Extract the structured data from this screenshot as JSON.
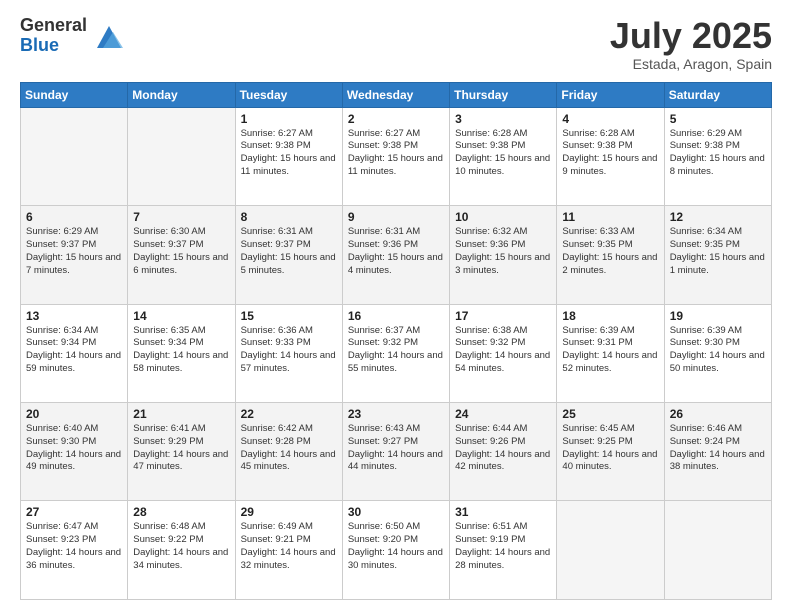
{
  "header": {
    "logo_general": "General",
    "logo_blue": "Blue",
    "month": "July 2025",
    "location": "Estada, Aragon, Spain"
  },
  "weekdays": [
    "Sunday",
    "Monday",
    "Tuesday",
    "Wednesday",
    "Thursday",
    "Friday",
    "Saturday"
  ],
  "weeks": [
    [
      {
        "day": "",
        "info": ""
      },
      {
        "day": "",
        "info": ""
      },
      {
        "day": "1",
        "info": "Sunrise: 6:27 AM\nSunset: 9:38 PM\nDaylight: 15 hours and 11 minutes."
      },
      {
        "day": "2",
        "info": "Sunrise: 6:27 AM\nSunset: 9:38 PM\nDaylight: 15 hours and 11 minutes."
      },
      {
        "day": "3",
        "info": "Sunrise: 6:28 AM\nSunset: 9:38 PM\nDaylight: 15 hours and 10 minutes."
      },
      {
        "day": "4",
        "info": "Sunrise: 6:28 AM\nSunset: 9:38 PM\nDaylight: 15 hours and 9 minutes."
      },
      {
        "day": "5",
        "info": "Sunrise: 6:29 AM\nSunset: 9:38 PM\nDaylight: 15 hours and 8 minutes."
      }
    ],
    [
      {
        "day": "6",
        "info": "Sunrise: 6:29 AM\nSunset: 9:37 PM\nDaylight: 15 hours and 7 minutes."
      },
      {
        "day": "7",
        "info": "Sunrise: 6:30 AM\nSunset: 9:37 PM\nDaylight: 15 hours and 6 minutes."
      },
      {
        "day": "8",
        "info": "Sunrise: 6:31 AM\nSunset: 9:37 PM\nDaylight: 15 hours and 5 minutes."
      },
      {
        "day": "9",
        "info": "Sunrise: 6:31 AM\nSunset: 9:36 PM\nDaylight: 15 hours and 4 minutes."
      },
      {
        "day": "10",
        "info": "Sunrise: 6:32 AM\nSunset: 9:36 PM\nDaylight: 15 hours and 3 minutes."
      },
      {
        "day": "11",
        "info": "Sunrise: 6:33 AM\nSunset: 9:35 PM\nDaylight: 15 hours and 2 minutes."
      },
      {
        "day": "12",
        "info": "Sunrise: 6:34 AM\nSunset: 9:35 PM\nDaylight: 15 hours and 1 minute."
      }
    ],
    [
      {
        "day": "13",
        "info": "Sunrise: 6:34 AM\nSunset: 9:34 PM\nDaylight: 14 hours and 59 minutes."
      },
      {
        "day": "14",
        "info": "Sunrise: 6:35 AM\nSunset: 9:34 PM\nDaylight: 14 hours and 58 minutes."
      },
      {
        "day": "15",
        "info": "Sunrise: 6:36 AM\nSunset: 9:33 PM\nDaylight: 14 hours and 57 minutes."
      },
      {
        "day": "16",
        "info": "Sunrise: 6:37 AM\nSunset: 9:32 PM\nDaylight: 14 hours and 55 minutes."
      },
      {
        "day": "17",
        "info": "Sunrise: 6:38 AM\nSunset: 9:32 PM\nDaylight: 14 hours and 54 minutes."
      },
      {
        "day": "18",
        "info": "Sunrise: 6:39 AM\nSunset: 9:31 PM\nDaylight: 14 hours and 52 minutes."
      },
      {
        "day": "19",
        "info": "Sunrise: 6:39 AM\nSunset: 9:30 PM\nDaylight: 14 hours and 50 minutes."
      }
    ],
    [
      {
        "day": "20",
        "info": "Sunrise: 6:40 AM\nSunset: 9:30 PM\nDaylight: 14 hours and 49 minutes."
      },
      {
        "day": "21",
        "info": "Sunrise: 6:41 AM\nSunset: 9:29 PM\nDaylight: 14 hours and 47 minutes."
      },
      {
        "day": "22",
        "info": "Sunrise: 6:42 AM\nSunset: 9:28 PM\nDaylight: 14 hours and 45 minutes."
      },
      {
        "day": "23",
        "info": "Sunrise: 6:43 AM\nSunset: 9:27 PM\nDaylight: 14 hours and 44 minutes."
      },
      {
        "day": "24",
        "info": "Sunrise: 6:44 AM\nSunset: 9:26 PM\nDaylight: 14 hours and 42 minutes."
      },
      {
        "day": "25",
        "info": "Sunrise: 6:45 AM\nSunset: 9:25 PM\nDaylight: 14 hours and 40 minutes."
      },
      {
        "day": "26",
        "info": "Sunrise: 6:46 AM\nSunset: 9:24 PM\nDaylight: 14 hours and 38 minutes."
      }
    ],
    [
      {
        "day": "27",
        "info": "Sunrise: 6:47 AM\nSunset: 9:23 PM\nDaylight: 14 hours and 36 minutes."
      },
      {
        "day": "28",
        "info": "Sunrise: 6:48 AM\nSunset: 9:22 PM\nDaylight: 14 hours and 34 minutes."
      },
      {
        "day": "29",
        "info": "Sunrise: 6:49 AM\nSunset: 9:21 PM\nDaylight: 14 hours and 32 minutes."
      },
      {
        "day": "30",
        "info": "Sunrise: 6:50 AM\nSunset: 9:20 PM\nDaylight: 14 hours and 30 minutes."
      },
      {
        "day": "31",
        "info": "Sunrise: 6:51 AM\nSunset: 9:19 PM\nDaylight: 14 hours and 28 minutes."
      },
      {
        "day": "",
        "info": ""
      },
      {
        "day": "",
        "info": ""
      }
    ]
  ]
}
